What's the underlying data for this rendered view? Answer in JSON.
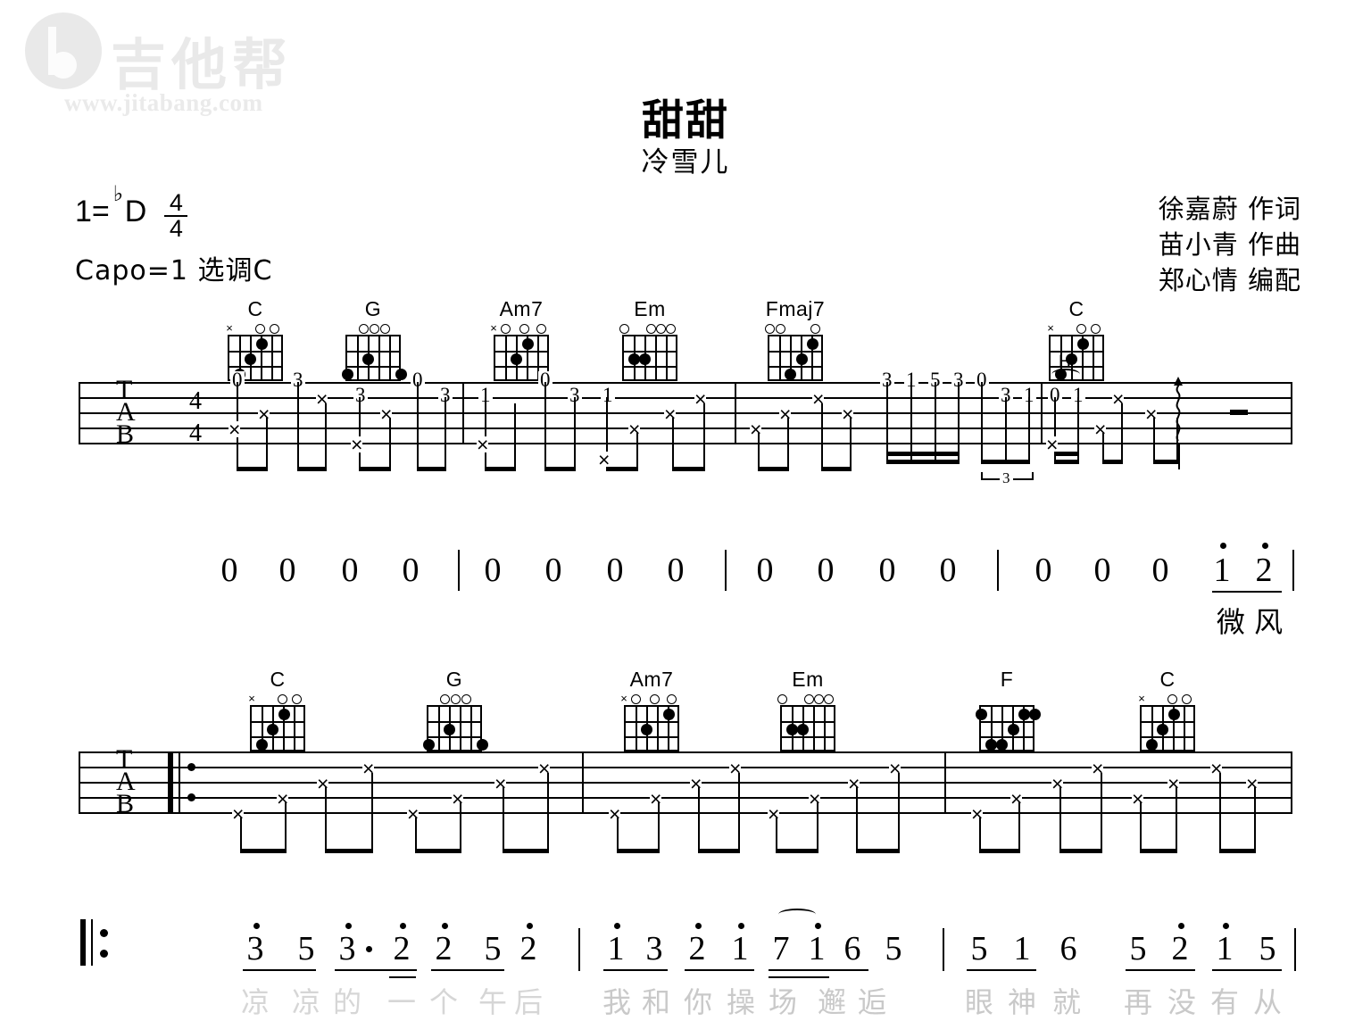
{
  "watermark": {
    "logo_text": "吉他帮",
    "url": "www.jitabang.com",
    "logo_icon": "b-circle-logo"
  },
  "header": {
    "title": "甜甜",
    "artist": "冷雪儿",
    "key_prefix": "1=",
    "key_flat": "♭",
    "key_note": "D",
    "time_numerator": "4",
    "time_denominator": "4",
    "capo": "Capo=1  选调C",
    "credits": [
      "徐嘉蔚  作词",
      "苗小青  作曲",
      "郑心情  编配"
    ]
  },
  "system1": {
    "chords": [
      {
        "name": "C",
        "marks": "x  o o"
      },
      {
        "name": "G",
        "marks": "o o o"
      },
      {
        "name": "Am7",
        "marks": "xo o o"
      },
      {
        "name": "Em",
        "marks": "o ooo"
      },
      {
        "name": "Fmaj7",
        "marks": "oo   o"
      },
      {
        "name": "C",
        "marks": "x  o o"
      }
    ],
    "clef": [
      "T",
      "A",
      "B"
    ],
    "time_numerator": "4",
    "time_denominator": "4",
    "tab_numbers": [
      "0",
      "3",
      "0",
      "3",
      "1",
      "0",
      "3",
      "1",
      "3",
      "1",
      "3",
      "5",
      "3",
      "0",
      "3",
      "1",
      "0",
      "1"
    ],
    "hammer_mark": "H",
    "triplet_mark": "3",
    "strum_icon": "arpeggio-up-arrow",
    "rest_icon": "half-rest"
  },
  "system1_melody": {
    "notes": [
      "0",
      "0",
      "0",
      "0",
      "0",
      "0",
      "0",
      "0",
      "0",
      "0",
      "0",
      "0",
      "0",
      "0",
      "0",
      "1",
      "2"
    ],
    "lyrics": "微 风"
  },
  "system2": {
    "chords": [
      {
        "name": "C",
        "marks": "x  o o"
      },
      {
        "name": "G",
        "marks": "o o o"
      },
      {
        "name": "Am7",
        "marks": "xo o o"
      },
      {
        "name": "Em",
        "marks": "o ooo"
      },
      {
        "name": "F",
        "marks": ""
      },
      {
        "name": "C",
        "marks": "x  o o"
      }
    ],
    "clef": [
      "T",
      "A",
      "B"
    ],
    "repeat_start": "repeat-begin-sign"
  },
  "system2_melody": {
    "repeat_start": "repeat-begin-sign",
    "measures": [
      {
        "notes": [
          "3",
          "5",
          "3",
          "2",
          "2",
          "5",
          "2"
        ],
        "lyrics": [
          "凉",
          "凉",
          "的",
          "一",
          "个",
          "午",
          "后"
        ]
      },
      {
        "notes": [
          "1",
          "3",
          "2",
          "1",
          "7",
          "1",
          "6",
          "5"
        ],
        "lyrics": [
          "我",
          "和",
          "你",
          "操",
          "场",
          "邂",
          "逅"
        ]
      },
      {
        "notes": [
          "5",
          "1",
          "6"
        ],
        "lyrics": [
          "眼",
          "神",
          "就"
        ]
      },
      {
        "notes": [
          "5",
          "2",
          "1",
          "5"
        ],
        "lyrics": [
          "再",
          "没",
          "有",
          "从"
        ]
      }
    ]
  },
  "colors": {
    "ink": "#000000",
    "watermark": "#e9e9e9",
    "lyric_fade": "#d0d0d0"
  }
}
